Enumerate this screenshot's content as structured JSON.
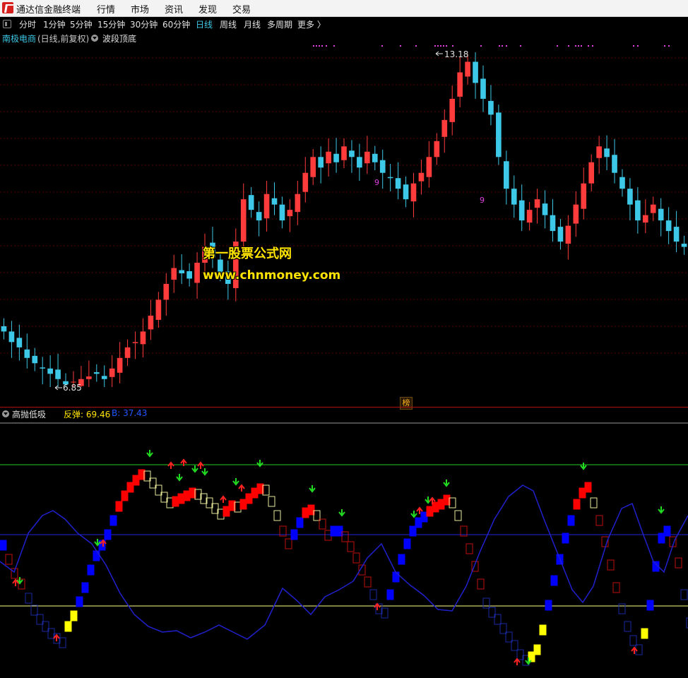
{
  "window": {
    "app_title": "通达信金融终端",
    "menus": [
      "行情",
      "市场",
      "资讯",
      "发现",
      "交易"
    ]
  },
  "toolbar": {
    "periods": [
      "分时",
      "1分钟",
      "5分钟",
      "15分钟",
      "30分钟",
      "60分钟",
      "日线",
      "周线",
      "月线",
      "多周期",
      "更多 〉"
    ],
    "active_period": "日线"
  },
  "main_chart": {
    "stock_name": "南极电商",
    "mode": "(日线,前复权)",
    "indicator": "波段顶底",
    "high_label": "13.18",
    "low_label": "6.85",
    "signal_marks": [
      "9",
      "9"
    ],
    "colors": {
      "up": "#ff3b3b",
      "down": "#3cc8e6",
      "grid": "#5a0000",
      "signal_dot": "#e040e0"
    }
  },
  "watermark": {
    "line1": "第一股票公式网",
    "line2": "www.chnmoney.com"
  },
  "badge": "榜",
  "sub_chart": {
    "indicator": "高抛低吸",
    "legend_rebound": "反弹: 69.46",
    "legend_b": "B: 37.43",
    "colors": {
      "top_line": "#22cc22",
      "mid_line": "#2222dd",
      "low_line": "#ffff88",
      "blue_line": "#2020cc",
      "red": "#ff0000",
      "blue": "#0000ff",
      "yellow": "#ffff00"
    }
  },
  "chart_data": {
    "type": "candlestick",
    "price_high": 13.18,
    "price_low": 6.85,
    "closes": [
      7.9,
      7.7,
      7.6,
      7.4,
      7.3,
      7.2,
      7.1,
      7.0,
      6.9,
      6.95,
      7.0,
      7.05,
      7.1,
      7.0,
      7.2,
      7.4,
      7.6,
      7.7,
      7.9,
      8.2,
      8.5,
      8.8,
      9.1,
      9.0,
      8.9,
      9.2,
      9.5,
      9.3,
      9.0,
      8.8,
      9.6,
      10.4,
      10.2,
      10.0,
      10.5,
      10.3,
      10.0,
      10.2,
      10.5,
      10.9,
      11.2,
      11.0,
      11.3,
      11.1,
      11.4,
      11.2,
      11.0,
      11.3,
      11.1,
      10.9,
      10.8,
      10.6,
      10.4,
      10.7,
      10.9,
      11.2,
      11.5,
      11.9,
      12.3,
      12.8,
      13.0,
      12.6,
      12.3,
      12.0,
      11.2,
      10.6,
      10.3,
      10.0,
      10.2,
      10.4,
      10.1,
      9.8,
      9.6,
      9.9,
      10.3,
      10.7,
      11.1,
      11.4,
      11.2,
      10.9,
      10.6,
      10.3,
      10.0,
      10.1,
      10.3,
      10.0,
      9.8,
      9.6,
      9.5
    ]
  }
}
